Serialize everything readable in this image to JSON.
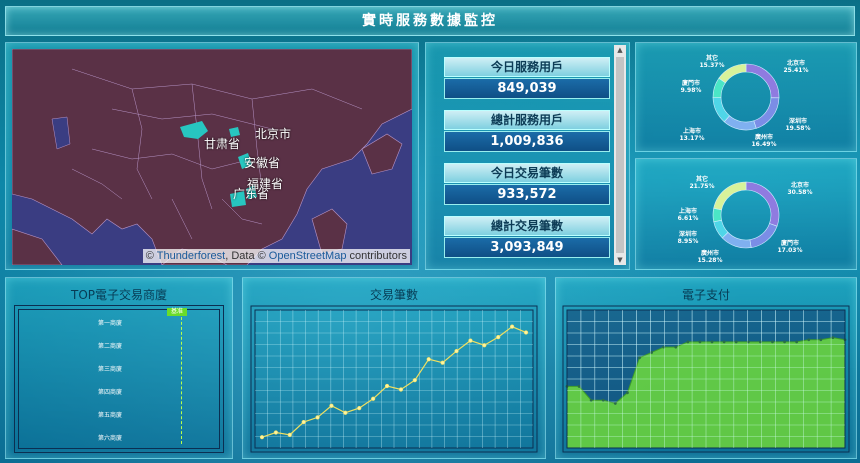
{
  "header": {
    "title": "實時服務數據監控"
  },
  "map": {
    "attribution_prefix": "©",
    "attribution_link1": "Thunderforest",
    "attribution_mid": ", Data ©",
    "attribution_link2": "OpenStreetMap",
    "attribution_suffix": "contributors",
    "provinces": [
      "甘肃省",
      "北京市",
      "安徽省",
      "福建省",
      "广东省"
    ],
    "highlight_color": "#27c6c0",
    "land_color": "#5a3146",
    "sea_color": "#3a3d82"
  },
  "stats": [
    {
      "label": "今日服務用戶",
      "value": "849,039"
    },
    {
      "label": "總計服務用戶",
      "value": "1,009,836"
    },
    {
      "label": "今日交易筆數",
      "value": "933,572"
    },
    {
      "label": "總計交易筆數",
      "value": "3,093,849"
    }
  ],
  "donut1": {
    "slices": [
      {
        "name": "北京市",
        "pct": "25.41%",
        "value": 25.41,
        "color": "#8f7be0"
      },
      {
        "name": "深圳市",
        "pct": "19.58%",
        "value": 19.58,
        "color": "#7b8de6"
      },
      {
        "name": "廣州市",
        "pct": "16.49%",
        "value": 16.49,
        "color": "#7fb0f0"
      },
      {
        "name": "上海市",
        "pct": "13.17%",
        "value": 13.17,
        "color": "#4fd6e8"
      },
      {
        "name": "廈門市",
        "pct": "9.98%",
        "value": 9.98,
        "color": "#4be6c6"
      },
      {
        "name": "其它",
        "pct": "15.37%",
        "value": 15.37,
        "color": "#d8f29a"
      }
    ]
  },
  "donut2": {
    "slices": [
      {
        "name": "北京市",
        "pct": "30.58%",
        "value": 30.58,
        "color": "#8f7be0"
      },
      {
        "name": "廈門市",
        "pct": "17.03%",
        "value": 17.03,
        "color": "#7b8de6"
      },
      {
        "name": "廣州市",
        "pct": "15.28%",
        "value": 15.28,
        "color": "#7fb0f0"
      },
      {
        "name": "深圳市",
        "pct": "8.95%",
        "value": 8.95,
        "color": "#4fd6e8"
      },
      {
        "name": "上海市",
        "pct": "6.61%",
        "value": 6.61,
        "color": "#4be6c6"
      },
      {
        "name": "其它",
        "pct": "21.75%",
        "value": 21.75,
        "color": "#d8f29a"
      }
    ]
  },
  "top_panel": {
    "title": "TOP電子交易商廈",
    "ranks": [
      "第一商廈",
      "第二商廈",
      "第三商廈",
      "第四商廈",
      "第五商廈",
      "第六商廈"
    ],
    "marker_label": "基准"
  },
  "trade_panel": {
    "title": "交易筆數"
  },
  "pay_panel": {
    "title": "電子支付"
  },
  "chart_data": [
    {
      "type": "line",
      "title": "交易筆數",
      "x": [
        1,
        2,
        3,
        4,
        5,
        6,
        7,
        8,
        9,
        10,
        11,
        12,
        13,
        14,
        15,
        16,
        17,
        18,
        19,
        20
      ],
      "values": [
        5,
        9,
        7,
        18,
        22,
        32,
        26,
        30,
        38,
        49,
        46,
        54,
        72,
        69,
        79,
        88,
        84,
        91,
        100,
        95
      ],
      "ylim": [
        0,
        110
      ],
      "line_color": "#f0e060",
      "grid": true
    },
    {
      "type": "area",
      "title": "電子支付",
      "x": [
        1,
        2,
        3,
        4,
        5,
        6,
        7,
        8,
        9,
        10,
        11,
        12,
        13,
        14,
        15,
        16,
        17,
        18,
        19,
        20,
        21,
        22,
        23,
        24
      ],
      "values": [
        58,
        58,
        45,
        45,
        42,
        52,
        85,
        90,
        95,
        95,
        100,
        100,
        100,
        100,
        100,
        100,
        100,
        100,
        100,
        100,
        102,
        102,
        104,
        102
      ],
      "ylim": [
        0,
        130
      ],
      "fill_color": "#6fdc3c",
      "grid": true
    }
  ]
}
